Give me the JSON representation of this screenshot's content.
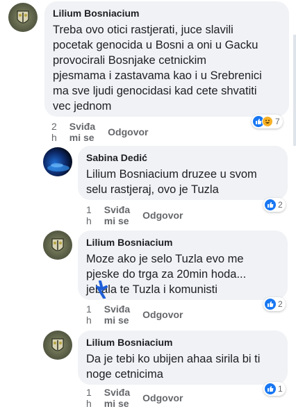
{
  "comments": [
    {
      "author": "Lilium Bosniacium",
      "text": "Treba ovo otici rastjerati, juce slavili\npocetak genocida u Bosni a oni u Gacku\nprovocirali Bosnjake cetnickim\npjesmama i zastavama kao i u Srebrenici\nma sve ljudi genocidasi kad cete shvatiti\nvec jednom",
      "time": "2 h",
      "like_label": "Sviđa mi se",
      "reply_label": "Odgovor",
      "reaction_count": "7",
      "reactions": [
        "like-icon",
        "haha-icon"
      ]
    },
    {
      "author": "Sabina Dedić",
      "text": "Lilium Bosniacium druzee u svom\nselu rastjeraj, ovo je Tuzla",
      "time": "1 h",
      "like_label": "Sviđa mi se",
      "reply_label": "Odgovor",
      "reaction_count": "2",
      "reactions": [
        "like-icon"
      ]
    },
    {
      "author": "Lilium Bosniacium",
      "text": "Moze ako je selo Tuzla evo me\npjeske do trga za 20min hoda...\njebala te Tuzla i komunisti",
      "time": "1 h",
      "like_label": "Sviđa mi se",
      "reply_label": "Odgovor",
      "reaction_count": "2",
      "reactions": [
        "like-icon"
      ]
    },
    {
      "author": "Lilium Bosniacium",
      "text": "Da je tebi ko ubijen ahaa sirila bi ti\nnoge cetnicima",
      "time": "1 h",
      "like_label": "Sviđa mi se",
      "reply_label": "Odgovor",
      "reaction_count": "1",
      "reactions": [
        "like-icon"
      ]
    }
  ],
  "colors": {
    "bubble": "#f0f2f5",
    "like": "#1877f2",
    "haha": "#f7b125",
    "meta": "#65676b",
    "scratch": "#1f5fd6"
  }
}
